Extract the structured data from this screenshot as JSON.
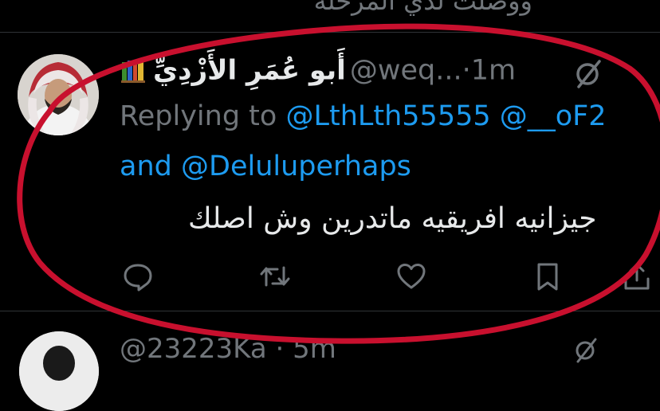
{
  "previous_tweet": {
    "cut_text": "ووصلت لدي المرحلة"
  },
  "tweet": {
    "display_name": "أَبو عُمَرِ الأَزْدِيِّ",
    "handle": "@weq...",
    "separator": "·",
    "time": "1m",
    "replying_prefix": "Replying to",
    "mentions": [
      "@LthLth55555",
      "@__oF2"
    ],
    "and_text": "and",
    "mention_last": "@Deluluperhaps",
    "text": "جيزانيه افريقيه ماتدرين وش اصلك",
    "icons": {
      "badge": "books-icon",
      "grok": "grok-icon",
      "reply": "reply-icon",
      "retweet": "retweet-icon",
      "like": "heart-icon",
      "bookmark": "bookmark-icon",
      "share": "share-icon"
    }
  },
  "next_tweet": {
    "handle_time": "@23223Ka · 5m"
  },
  "colors": {
    "background": "#000000",
    "text": "#e7e9ea",
    "secondary": "#71767b",
    "link": "#1d9bf0",
    "annotation": "#c8102e"
  }
}
